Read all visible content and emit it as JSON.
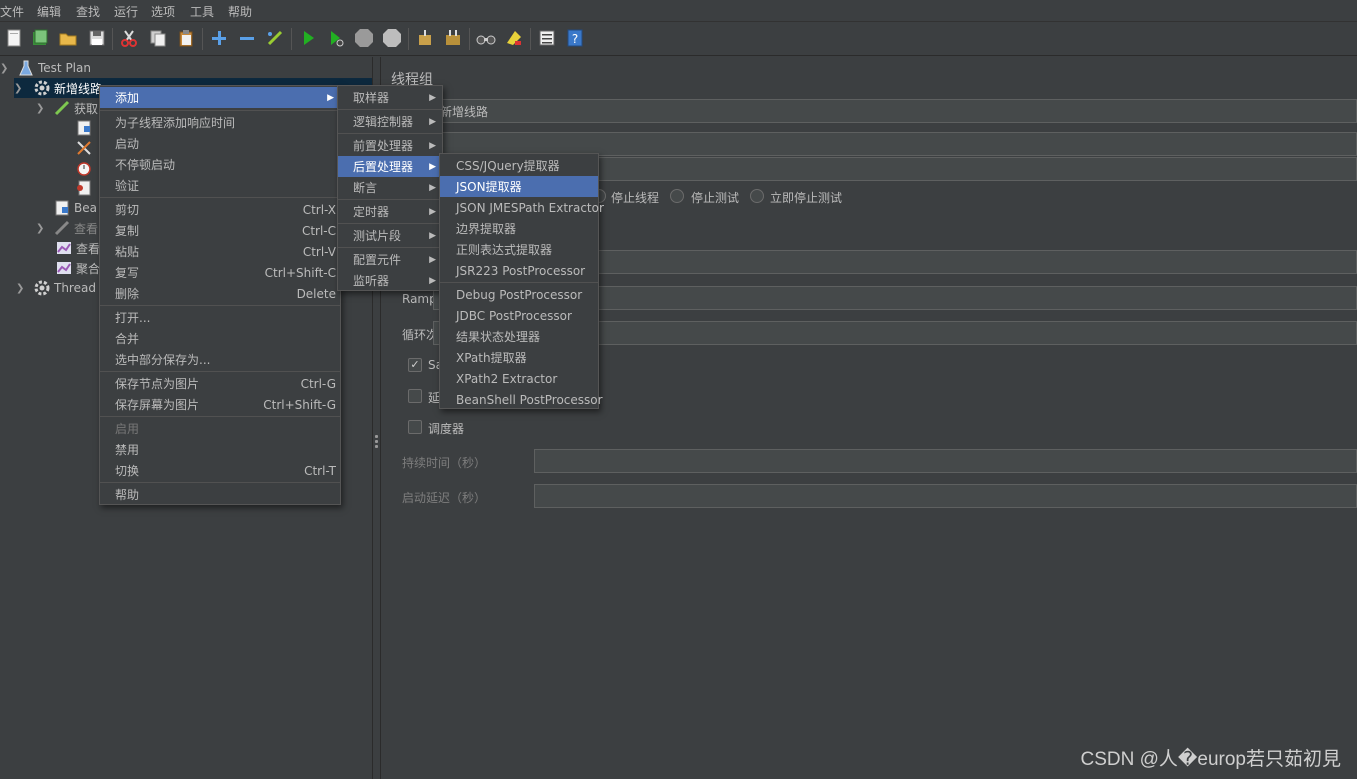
{
  "menubar": [
    "文件",
    "编辑",
    "查找",
    "运行",
    "选项",
    "工具",
    "帮助"
  ],
  "tree": {
    "test_plan": "Test Plan",
    "thread_group_selected": "新增线路",
    "child_get": "获取",
    "bean": "Bea",
    "view1": "查看",
    "view2": "查看",
    "aggregate": "聚合",
    "thread_group2": "Thread"
  },
  "context_menu": {
    "add": "添加",
    "add_resp_time": "为子线程添加响应时间",
    "start": "启动",
    "start_no_pause": "不停顿启动",
    "validate": "验证",
    "cut": "剪切",
    "cut_key": "Ctrl-X",
    "copy": "复制",
    "copy_key": "Ctrl-C",
    "paste": "粘贴",
    "paste_key": "Ctrl-V",
    "duplicate": "复写",
    "duplicate_key": "Ctrl+Shift-C",
    "delete": "删除",
    "delete_key": "Delete",
    "open": "打开...",
    "merge": "合并",
    "save_selection": "选中部分保存为...",
    "save_node_img": "保存节点为图片",
    "save_node_img_key": "Ctrl-G",
    "save_screen_img": "保存屏幕为图片",
    "save_screen_img_key": "Ctrl+Shift-G",
    "enable": "启用",
    "disable": "禁用",
    "toggle": "切换",
    "toggle_key": "Ctrl-T",
    "help": "帮助"
  },
  "add_menu": {
    "sampler": "取样器",
    "logic_controller": "逻辑控制器",
    "pre_processor": "前置处理器",
    "post_processor": "后置处理器",
    "assertion": "断言",
    "timer": "定时器",
    "test_fragment": "测试片段",
    "config_element": "配置元件",
    "listener": "监听器"
  },
  "post_menu": {
    "css": "CSS/JQuery提取器",
    "json": "JSON提取器",
    "jmespath": "JSON JMESPath Extractor",
    "boundary": "边界提取器",
    "regex": "正则表达式提取器",
    "jsr223": "JSR223 PostProcessor",
    "debug": "Debug PostProcessor",
    "jdbc": "JDBC PostProcessor",
    "result_status": "结果状态处理器",
    "xpath": "XPath提取器",
    "xpath2": "XPath2 Extractor",
    "beanshell": "BeanShell PostProcessor"
  },
  "right_panel": {
    "title": "线程组",
    "name_value": "新增线路",
    "action_stop_thread": "停止线程",
    "action_stop_test": "停止测试",
    "action_stop_now": "立即停止测试",
    "ramp_label": "Ramp-",
    "loop_label": "循环次",
    "same_user_label": "Sa",
    "delay_label": "延",
    "scheduler_label": "调度器",
    "duration_label": "持续时间（秒）",
    "startup_delay_label": "启动延迟（秒）"
  },
  "watermark": "CSDN @人�europ若只茹初見",
  "colors": {
    "highlight": "#4b6eaf",
    "background": "#3c3f41",
    "tree_selected": "#0d293e"
  }
}
